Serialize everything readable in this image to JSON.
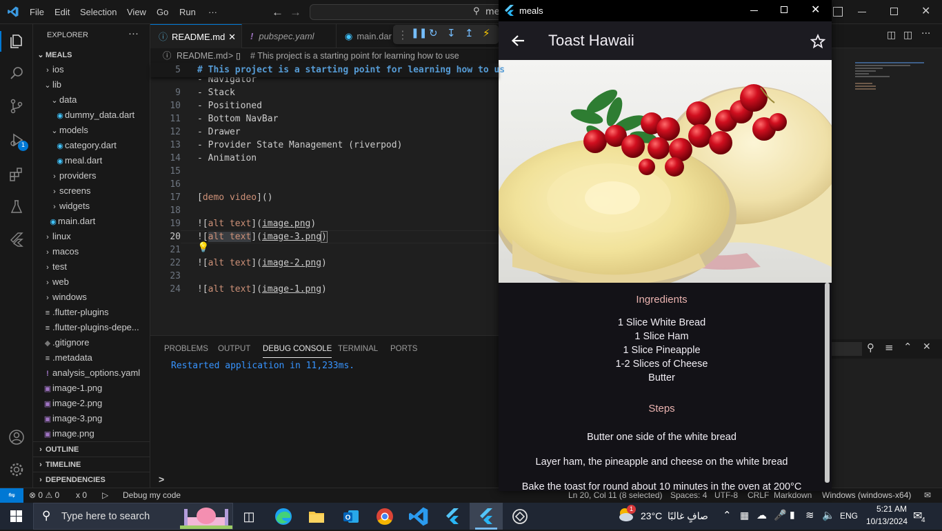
{
  "vscode": {
    "menu": [
      "File",
      "Edit",
      "Selection",
      "View",
      "Go",
      "Run",
      "···"
    ],
    "search_text": "me",
    "explorer": {
      "title": "EXPLORER",
      "root": "MEALS",
      "items": [
        {
          "label": "ios"
        },
        {
          "label": "lib"
        },
        {
          "label": "data"
        },
        {
          "label": "dummy_data.dart"
        },
        {
          "label": "models"
        },
        {
          "label": "category.dart"
        },
        {
          "label": "meal.dart"
        },
        {
          "label": "providers"
        },
        {
          "label": "screens"
        },
        {
          "label": "widgets"
        },
        {
          "label": "main.dart"
        },
        {
          "label": "linux"
        },
        {
          "label": "macos"
        },
        {
          "label": "test"
        },
        {
          "label": "web"
        },
        {
          "label": "windows"
        },
        {
          "label": ".flutter-plugins"
        },
        {
          "label": ".flutter-plugins-depe..."
        },
        {
          "label": ".gitignore"
        },
        {
          "label": ".metadata"
        },
        {
          "label": "analysis_options.yaml"
        },
        {
          "label": "image-1.png"
        },
        {
          "label": "image-2.png"
        },
        {
          "label": "image-3.png"
        },
        {
          "label": "image.png"
        }
      ],
      "outline": "OUTLINE",
      "timeline": "TIMELINE",
      "dependencies": "DEPENDENCIES"
    },
    "tabs": [
      {
        "label": "README.md"
      },
      {
        "label": "pubspec.yaml"
      },
      {
        "label": "main.dar"
      }
    ],
    "breadcrumb": {
      "file": "README.md",
      "sep": ">",
      "section": "# This project is a starting point for learning how to use"
    },
    "editor": {
      "line5_num": "5",
      "line5": "# This project is a starting point for learning how to us",
      "lines": [
        {
          "num": "",
          "text": "- Navigator"
        },
        {
          "num": "9",
          "text": "- Stack"
        },
        {
          "num": "10",
          "text": "- Positioned"
        },
        {
          "num": "11",
          "text": "- Bottom NavBar"
        },
        {
          "num": "12",
          "text": "- Drawer"
        },
        {
          "num": "13",
          "text": "- Provider State Management (riverpod)"
        },
        {
          "num": "14",
          "text": "- Animation"
        },
        {
          "num": "15",
          "text": ""
        },
        {
          "num": "16",
          "text": ""
        }
      ],
      "l17_num": "17",
      "l17_open": "[",
      "l17_link": "demo video",
      "l17_close": "]()",
      "l18_num": "18",
      "img_lines": [
        {
          "num": "19",
          "alt": "alt text",
          "url": "image.png"
        },
        {
          "num": "20",
          "alt": "alt text",
          "url": "image-3.png"
        },
        {
          "num": "22",
          "alt": "alt text",
          "url": "image-2.png"
        },
        {
          "num": "24",
          "alt": "alt text",
          "url": "image-1.png"
        }
      ],
      "l21_num": "21",
      "l23_num": "23",
      "bang_open": "![",
      "close_paren_open": "](",
      "close_paren": ")"
    },
    "panel": {
      "tabs": [
        "PROBLEMS",
        "OUTPUT",
        "DEBUG CONSOLE",
        "TERMINAL",
        "PORTS"
      ],
      "console": "Restarted application in 11,233ms.",
      "prompt": ">"
    },
    "statusbar": {
      "errors": "0",
      "warnings": "0",
      "ports": "0",
      "debug": "Debug my code",
      "position": "Ln 20, Col 11 (8 selected)",
      "spaces": "Spaces: 4",
      "encoding": "UTF-8",
      "eol": "CRLF",
      "language": "Markdown",
      "device": "Windows (windows-x64)"
    }
  },
  "app": {
    "window_title": "meals",
    "title": "Toast Hawaii",
    "ingredients_title": "Ingredients",
    "ingredients": [
      "1 Slice White Bread",
      "1 Slice Ham",
      "1 Slice Pineapple",
      "1-2 Slices of Cheese",
      "Butter"
    ],
    "steps_title": "Steps",
    "steps": [
      "Butter one side of the white bread",
      "Layer ham, the pineapple and cheese on the white bread",
      "Bake the toast for round about 10 minutes in the oven at 200°C"
    ]
  },
  "taskbar": {
    "search_placeholder": "Type here to search",
    "weather": "23°C",
    "weather_desc": "صافٍ غالبًا",
    "weather_badge": "1",
    "lang": "ENG",
    "time": "5:21 AM",
    "date": "10/13/2024",
    "notif": "4"
  },
  "colors": {
    "accent": "#0078d4",
    "app_section_title": "#eab3b0",
    "console_blue": "#3794ff"
  }
}
